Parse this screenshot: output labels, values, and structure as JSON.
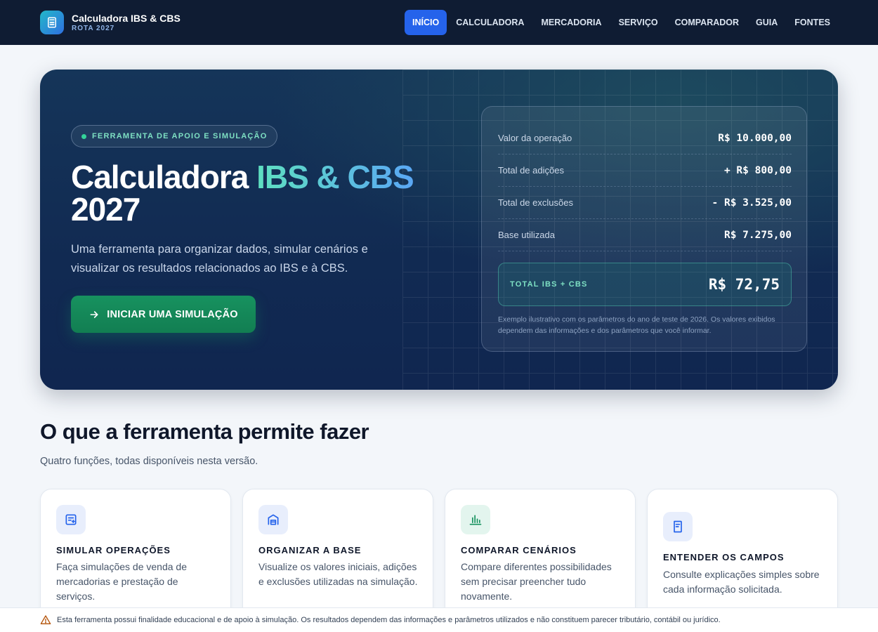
{
  "header": {
    "brand_title": "Calculadora IBS & CBS",
    "brand_subtitle": "ROTA 2027",
    "nav": [
      {
        "label": "INÍCIO",
        "active": true
      },
      {
        "label": "CALCULADORA"
      },
      {
        "label": "MERCADORIA"
      },
      {
        "label": "SERVIÇO"
      },
      {
        "label": "COMPARADOR"
      },
      {
        "label": "GUIA"
      },
      {
        "label": "FONTES"
      }
    ]
  },
  "hero": {
    "badge": "FERRAMENTA DE APOIO E SIMULAÇÃO",
    "title_prefix": "Calculadora ",
    "title_highlight": "IBS & CBS",
    "title_suffix": "2027",
    "description": "Uma ferramenta para organizar dados, simular cenários e visualizar os resultados relacionados ao IBS e à CBS.",
    "cta_label": "INICIAR UMA SIMULAÇÃO"
  },
  "summary": {
    "rows": [
      {
        "label": "Valor da operação",
        "value": "R$ 10.000,00"
      },
      {
        "label": "Total de adições",
        "value": "+ R$ 800,00"
      },
      {
        "label": "Total de exclusões",
        "value": "- R$ 3.525,00"
      },
      {
        "label": "Base utilizada",
        "value": "R$ 7.275,00"
      }
    ],
    "total_label": "TOTAL IBS + CBS",
    "total_value": "R$ 72,75",
    "note": "Exemplo ilustrativo com os parâmetros do ano de teste de 2026. Os valores exibidos dependem das informações e dos parâmetros que você informar."
  },
  "features": {
    "title": "O que a ferramenta permite fazer",
    "subtitle": "Quatro funções, todas disponíveis nesta versão.",
    "items": [
      {
        "icon": "document-list-icon",
        "title": "SIMULAR OPERAÇÕES",
        "desc": "Faça simulações de venda de mercadorias e prestação de serviços."
      },
      {
        "icon": "warehouse-icon",
        "title": "ORGANIZAR A BASE",
        "desc": "Visualize os valores iniciais, adições e exclusões utilizadas na simulação."
      },
      {
        "icon": "bar-chart-icon",
        "title": "COMPARAR CENÁRIOS",
        "desc": "Compare diferentes possibilidades sem precisar preencher tudo novamente."
      },
      {
        "icon": "book-icon",
        "title": "ENTENDER OS CAMPOS",
        "desc": "Consulte explicações simples sobre cada informação solicitada."
      }
    ]
  },
  "footer": {
    "disclaimer": "Esta ferramenta possui finalidade educacional e de apoio à simulação. Os resultados dependem das informações e parâmetros utilizados e não constituem parecer tributário, contábil ou jurídico."
  },
  "colors": {
    "nav_bg": "#0f1c33",
    "accent_blue": "#2563eb",
    "accent_green": "#17925f",
    "highlight_teal": "#5ee0c0"
  }
}
